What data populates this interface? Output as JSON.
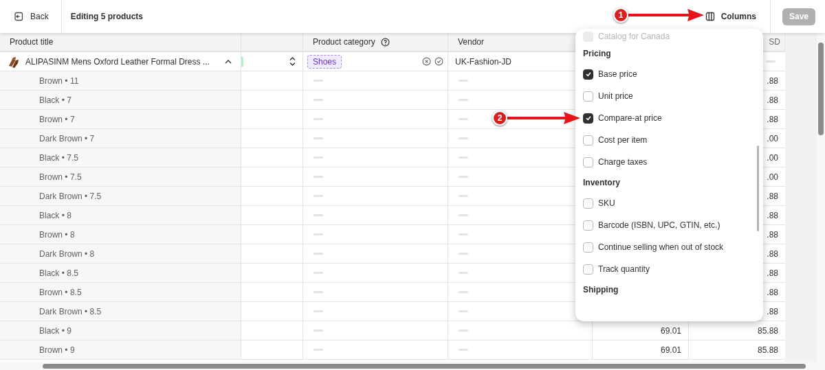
{
  "topbar": {
    "back": "Back",
    "title": "Editing 5 products",
    "columns_button": "Columns",
    "save": {
      "label": "Save",
      "disabled": true
    }
  },
  "table": {
    "columns": [
      {
        "label": "Product title"
      },
      {},
      {
        "label": "Product category"
      },
      {
        "label": "Vendor"
      },
      {},
      {
        "label": "SD"
      }
    ],
    "product": {
      "title": "ALIPASINM Mens Oxford Leather Formal Dress ...",
      "expanded": true,
      "category": "Shoes",
      "vendor": "UK-Fashion-JD"
    },
    "rows": [
      {
        "variant": "Brown • 11",
        "column_6": ".88"
      },
      {
        "variant": "Black • 7",
        "column_6": ".88"
      },
      {
        "variant": "Brown • 7",
        "column_6": ".88"
      },
      {
        "variant": "Dark Brown • 7",
        "column_6": ".00"
      },
      {
        "variant": "Black • 7.5",
        "column_6": ".00"
      },
      {
        "variant": "Brown • 7.5",
        "column_6": ".00"
      },
      {
        "variant": "Dark Brown • 7.5",
        "column_6": ".88"
      },
      {
        "variant": "Black • 8",
        "column_6": ".88"
      },
      {
        "variant": "Brown • 8",
        "column_6": ".88"
      },
      {
        "variant": "Dark Brown • 8",
        "column_6": ".88"
      },
      {
        "variant": "Black • 8.5",
        "column_6": ".88"
      },
      {
        "variant": "Brown • 8.5",
        "column_6": ".88"
      },
      {
        "variant": "Dark Brown • 8.5",
        "column_6": ".88"
      },
      {
        "variant": "Black • 9",
        "column_5": "69.01",
        "column_6": "85.88"
      },
      {
        "variant": "Brown • 9",
        "column_5": "69.01",
        "column_6": "85.88"
      }
    ]
  },
  "columns_menu": {
    "items": [
      {
        "kind": "checkbox",
        "label": "Catalog for Canada",
        "checked": false,
        "disabled": true
      },
      {
        "kind": "heading",
        "label": "Pricing"
      },
      {
        "kind": "checkbox",
        "label": "Base price",
        "checked": true,
        "disabled": false
      },
      {
        "kind": "checkbox",
        "label": "Unit price",
        "checked": false,
        "disabled": false
      },
      {
        "kind": "checkbox",
        "label": "Compare-at price",
        "checked": true,
        "disabled": false
      },
      {
        "kind": "checkbox",
        "label": "Cost per item",
        "checked": false,
        "disabled": false
      },
      {
        "kind": "checkbox",
        "label": "Charge taxes",
        "checked": false,
        "disabled": false
      },
      {
        "kind": "heading",
        "label": "Inventory"
      },
      {
        "kind": "checkbox",
        "label": "SKU",
        "checked": false,
        "disabled": false
      },
      {
        "kind": "checkbox",
        "label": "Barcode (ISBN, UPC, GTIN, etc.)",
        "checked": false,
        "disabled": false
      },
      {
        "kind": "checkbox",
        "label": "Continue selling when out of stock",
        "checked": false,
        "disabled": false
      },
      {
        "kind": "checkbox",
        "label": "Track quantity",
        "checked": false,
        "disabled": false
      },
      {
        "kind": "heading",
        "label": "Shipping"
      }
    ]
  },
  "annotations": [
    "1",
    "2"
  ]
}
